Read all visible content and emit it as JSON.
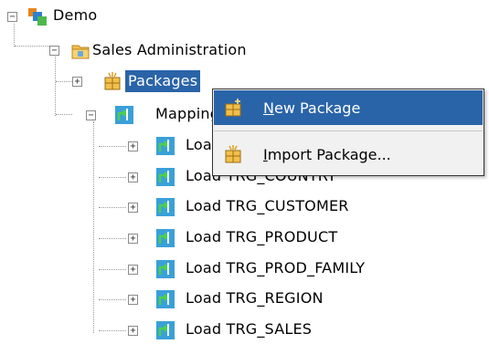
{
  "tree": {
    "root": {
      "label": "Demo",
      "toggle": "−"
    },
    "folder": {
      "label": "Sales Administration",
      "toggle": "−"
    },
    "packages": {
      "label": "Packages",
      "toggle": "+"
    },
    "mappings": {
      "label": "Mappings",
      "toggle": "−"
    },
    "mapping_items": [
      {
        "label": "Load TRG_CITY",
        "toggle": "+"
      },
      {
        "label": "Load TRG_COUNTRY",
        "toggle": "+"
      },
      {
        "label": "Load TRG_CUSTOMER",
        "toggle": "+"
      },
      {
        "label": "Load TRG_PRODUCT",
        "toggle": "+"
      },
      {
        "label": "Load TRG_PROD_FAMILY",
        "toggle": "+"
      },
      {
        "label": "Load TRG_REGION",
        "toggle": "+"
      },
      {
        "label": "Load TRG_SALES",
        "toggle": "+"
      }
    ]
  },
  "context_menu": {
    "items": [
      {
        "mnemonic": "N",
        "rest": "ew Package",
        "label": "New Package"
      },
      {
        "mnemonic": "I",
        "rest": "mport Package...",
        "label": "Import Package..."
      }
    ]
  },
  "colors": {
    "selection": "#2a64a8",
    "folder": "#f2c04a",
    "mapping_icon": "#3aa0d8"
  },
  "icons": {
    "project": "project-icon",
    "folder": "folder-icon",
    "package": "package-icon",
    "mapping": "mapping-icon"
  }
}
